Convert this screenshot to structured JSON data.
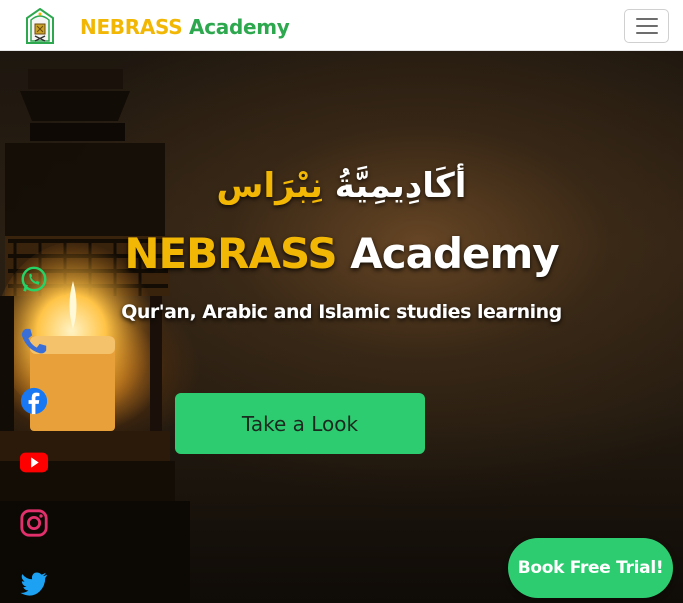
{
  "navbar": {
    "logo_icon": "mosque-lantern-logo-icon",
    "brand_part1": "NEBRASS",
    "brand_part2": "Academy",
    "menu_icon": "hamburger-menu-icon"
  },
  "hero": {
    "arabic_part1": "أكَادِيمِيَّةُ",
    "arabic_part2": "نِبْرَاس",
    "title_part1": "NEBRASS",
    "title_part2": "Academy",
    "subtitle": "Qur'an, Arabic and Islamic studies learning",
    "cta_label": "Take a Look"
  },
  "social": [
    {
      "name": "whatsapp-icon",
      "color": "#25d366"
    },
    {
      "name": "phone-icon",
      "color": "#3b6fd8"
    },
    {
      "name": "facebook-icon",
      "color": "#1877f2"
    },
    {
      "name": "youtube-icon",
      "color": "#ff0000"
    },
    {
      "name": "instagram-icon",
      "color": "#e1306c"
    },
    {
      "name": "twitter-icon",
      "color": "#1da1f2"
    }
  ],
  "book_trial_label": "Book Free Trial!",
  "colors": {
    "brand_gold": "#f2b705",
    "brand_green": "#2ea84f",
    "cta_green": "#2ecc71"
  }
}
